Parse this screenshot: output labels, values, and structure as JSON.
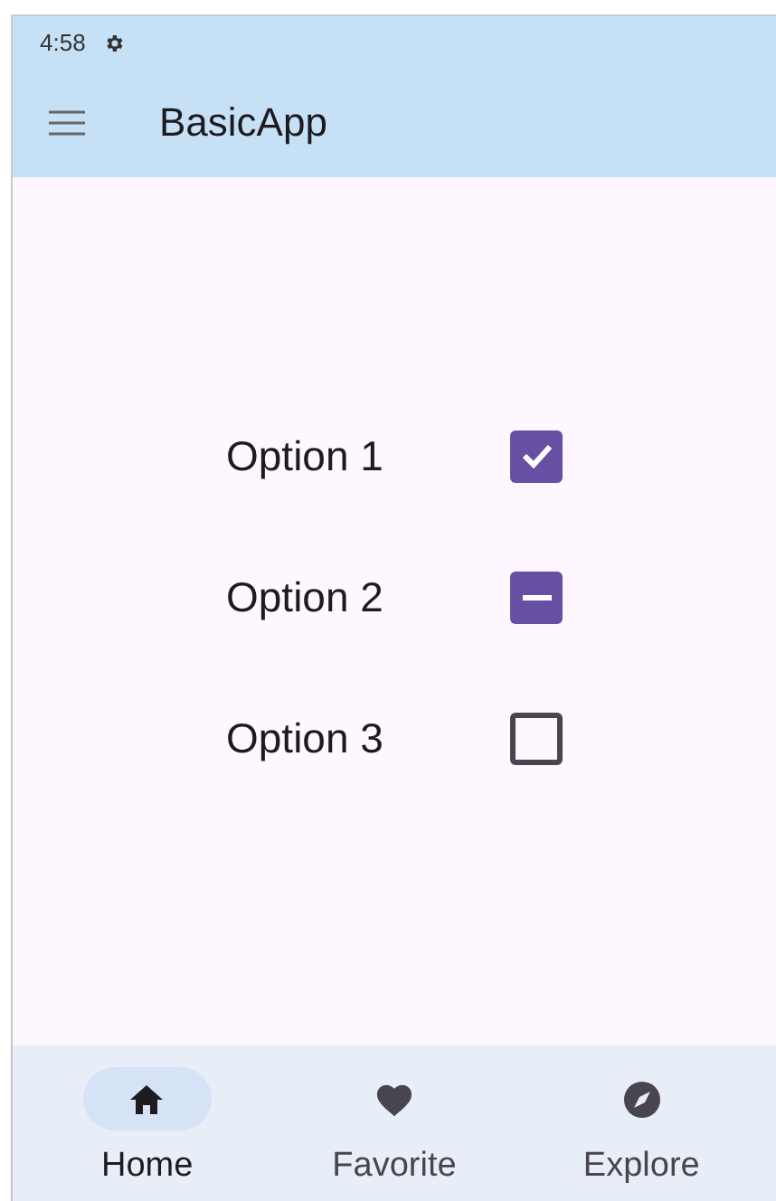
{
  "status_bar": {
    "time": "4:58"
  },
  "app_bar": {
    "title": "BasicApp"
  },
  "options": [
    {
      "label": "Option 1",
      "kind": "checkbox",
      "checked": true
    },
    {
      "label": "Option 2",
      "kind": "indeterminate",
      "checked": true
    },
    {
      "label": "Option 3",
      "kind": "checkbox",
      "checked": false
    }
  ],
  "navigation": [
    {
      "label": "Home",
      "selected": true
    },
    {
      "label": "Favorite",
      "selected": false
    },
    {
      "label": "Explore",
      "selected": false
    }
  ]
}
